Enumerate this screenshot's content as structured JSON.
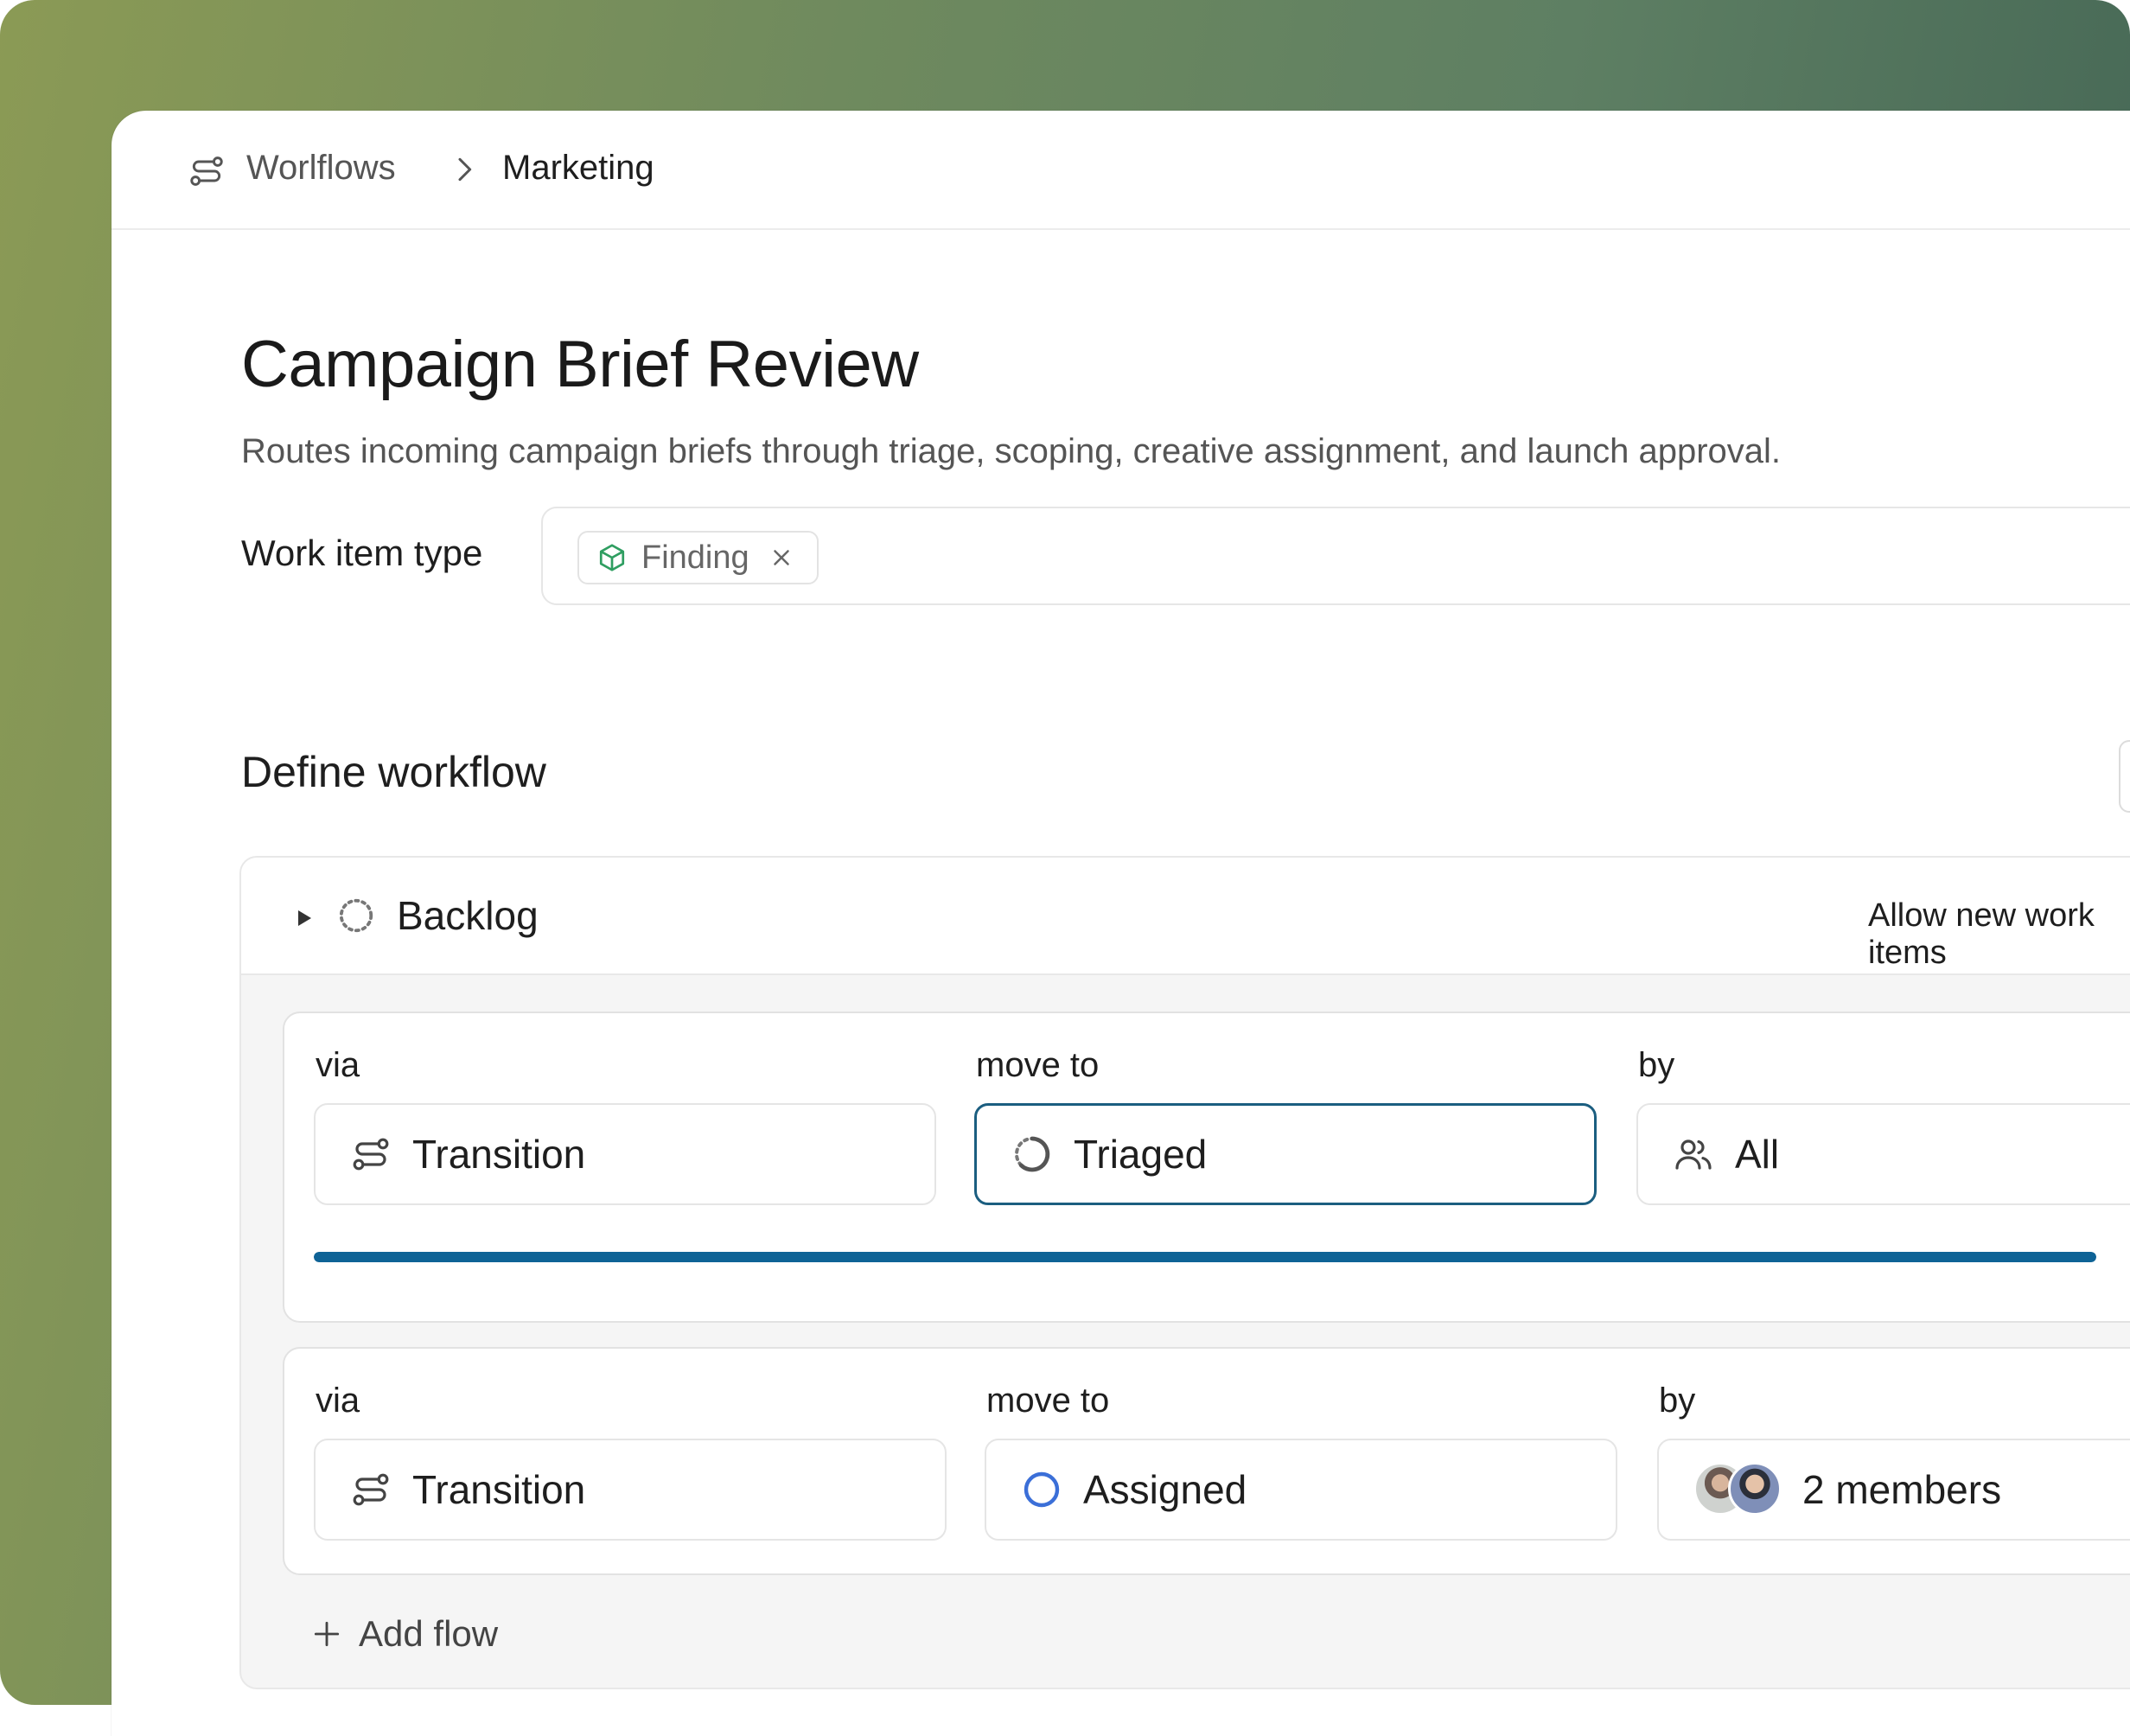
{
  "breadcrumb": {
    "root": "Worlflows",
    "current": "Marketing"
  },
  "page": {
    "title": "Campaign Brief Review",
    "description": "Routes incoming campaign briefs through triage, scoping, creative assignment, and launch approval."
  },
  "work_item_type": {
    "label": "Work item type",
    "chip": "Finding"
  },
  "define_workflow": {
    "title": "Define workflow",
    "state": {
      "name": "Backlog",
      "allow_label": "Allow new work items",
      "allow_enabled": true
    },
    "flows": [
      {
        "via_label": "via",
        "via_value": "Transition",
        "move_label": "move to",
        "move_value": "Triaged",
        "by_label": "by",
        "by_value": "All",
        "progress": 1.0,
        "focused": true
      },
      {
        "via_label": "via",
        "via_value": "Transition",
        "move_label": "move to",
        "move_value": "Assigned",
        "by_label": "by",
        "by_value": "2 members"
      }
    ],
    "add_flow": "Add flow"
  },
  "icons": {
    "breadcrumb": "workflow-icon",
    "separator": "chevron-right-icon",
    "chip": "cube-icon",
    "chip_remove": "close-icon",
    "caret": "caret-right-icon",
    "backlog": "dashed-circle-icon",
    "transition": "workflow-icon",
    "triaged": "partial-circle-icon",
    "assigned": "circle-icon",
    "all": "users-icon",
    "add": "plus-icon"
  },
  "colors": {
    "accent": "#0e6396",
    "assigned_ring": "#3b6fd8",
    "chip_icon": "#2f9e61"
  }
}
